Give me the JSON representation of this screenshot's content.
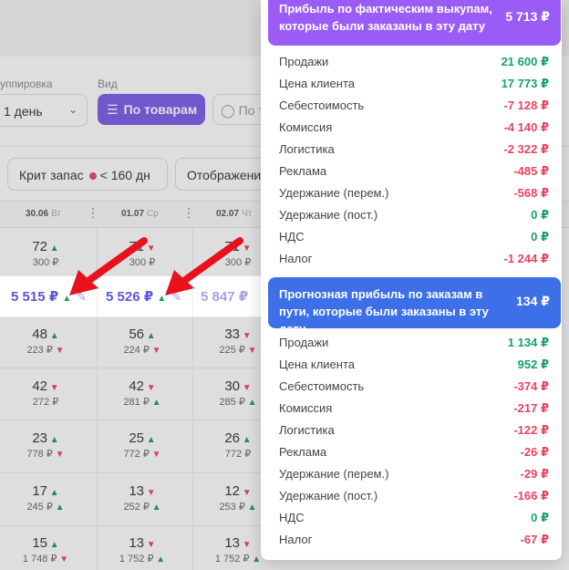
{
  "background": {
    "grouping_label": "уппировка",
    "view_label": "Вид",
    "period_select": "1 день",
    "view_button": "По товарам",
    "view_button_ghost": "По т",
    "stock_chip": "Крит запас",
    "stock_value": "< 160 дн",
    "display_chip": "Отображени",
    "columns": [
      {
        "date": "30.06",
        "day": "Вт"
      },
      {
        "date": "01.07",
        "day": "Ср"
      },
      {
        "date": "02.07",
        "day": "Чт"
      }
    ],
    "highlight_values": [
      "5 515 ₽",
      "5 526 ₽",
      "5 847 ₽"
    ],
    "rows": [
      [
        {
          "n": "72",
          "d": "up",
          "s": "300 ₽",
          "sd": ""
        },
        {
          "n": "71",
          "d": "dn",
          "s": "300 ₽",
          "sd": ""
        },
        {
          "n": "71",
          "d": "dn",
          "s": "300 ₽",
          "sd": ""
        }
      ],
      [
        {
          "n": "48",
          "d": "up",
          "s": "223 ₽",
          "sd": "dn"
        },
        {
          "n": "56",
          "d": "up",
          "s": "224 ₽",
          "sd": "dn"
        },
        {
          "n": "33",
          "d": "dn",
          "s": "225 ₽",
          "sd": "dn"
        }
      ],
      [
        {
          "n": "42",
          "d": "dn",
          "s": "272 ₽",
          "sd": ""
        },
        {
          "n": "42",
          "d": "dn",
          "s": "281 ₽",
          "sd": "up"
        },
        {
          "n": "30",
          "d": "dn",
          "s": "285 ₽",
          "sd": "up"
        }
      ],
      [
        {
          "n": "23",
          "d": "up",
          "s": "778 ₽",
          "sd": "dn"
        },
        {
          "n": "25",
          "d": "up",
          "s": "772 ₽",
          "sd": "dn"
        },
        {
          "n": "26",
          "d": "up",
          "s": "772 ₽",
          "sd": ""
        }
      ],
      [
        {
          "n": "17",
          "d": "up",
          "s": "245 ₽",
          "sd": "up"
        },
        {
          "n": "13",
          "d": "dn",
          "s": "252 ₽",
          "sd": "up"
        },
        {
          "n": "12",
          "d": "dn",
          "s": "253 ₽",
          "sd": "up"
        }
      ],
      [
        {
          "n": "15",
          "d": "up",
          "s": "1 748 ₽",
          "sd": "dn"
        },
        {
          "n": "13",
          "d": "dn",
          "s": "1 752 ₽",
          "sd": "up"
        },
        {
          "n": "13",
          "d": "dn",
          "s": "1 752 ₽",
          "sd": "up"
        }
      ]
    ]
  },
  "panel": {
    "section1": {
      "title": "Прибыль по фактическим выкупам, которые были заказаны в эту дату",
      "total": "5 713 ₽",
      "color": "#9b5cf6",
      "items": [
        {
          "label": "Продажи",
          "value": "21 600 ₽",
          "sign": "pos"
        },
        {
          "label": "Цена клиента",
          "value": "17 773 ₽",
          "sign": "pos"
        },
        {
          "label": "Себестоимость",
          "value": "-7 128 ₽",
          "sign": "neg"
        },
        {
          "label": "Комиссия",
          "value": "-4 140 ₽",
          "sign": "neg"
        },
        {
          "label": "Логистика",
          "value": "-2 322 ₽",
          "sign": "neg"
        },
        {
          "label": "Реклама",
          "value": "-485 ₽",
          "sign": "neg"
        },
        {
          "label": "Удержание (перем.)",
          "value": "-568 ₽",
          "sign": "neg"
        },
        {
          "label": "Удержание (пост.)",
          "value": "0 ₽",
          "sign": "pos"
        },
        {
          "label": "НДС",
          "value": "0 ₽",
          "sign": "pos"
        },
        {
          "label": "Налог",
          "value": "-1 244 ₽",
          "sign": "neg"
        }
      ]
    },
    "section2": {
      "title": "Прогнозная прибыль по заказам в пути, которые были заказаны в эту дату",
      "total": "134 ₽",
      "color": "#3d6fe8",
      "items": [
        {
          "label": "Продажи",
          "value": "1 134 ₽",
          "sign": "pos"
        },
        {
          "label": "Цена клиента",
          "value": "952 ₽",
          "sign": "pos"
        },
        {
          "label": "Себестоимость",
          "value": "-374 ₽",
          "sign": "neg"
        },
        {
          "label": "Комиссия",
          "value": "-217 ₽",
          "sign": "neg"
        },
        {
          "label": "Логистика",
          "value": "-122 ₽",
          "sign": "neg"
        },
        {
          "label": "Реклама",
          "value": "-26 ₽",
          "sign": "neg"
        },
        {
          "label": "Удержание (перем.)",
          "value": "-29 ₽",
          "sign": "neg"
        },
        {
          "label": "Удержание (пост.)",
          "value": "-166 ₽",
          "sign": "neg"
        },
        {
          "label": "НДС",
          "value": "0 ₽",
          "sign": "pos"
        },
        {
          "label": "Налог",
          "value": "-67 ₽",
          "sign": "neg"
        }
      ]
    }
  },
  "icons": {
    "list": "list-icon",
    "tag": "tag-icon",
    "edit": "edit-icon",
    "chevron": "chevron-down-icon",
    "kebab": "kebab-icon"
  },
  "colors": {
    "accent": "#7b5be8",
    "positive": "#16a368",
    "negative": "#e8455f",
    "arrow": "#e8111c"
  }
}
